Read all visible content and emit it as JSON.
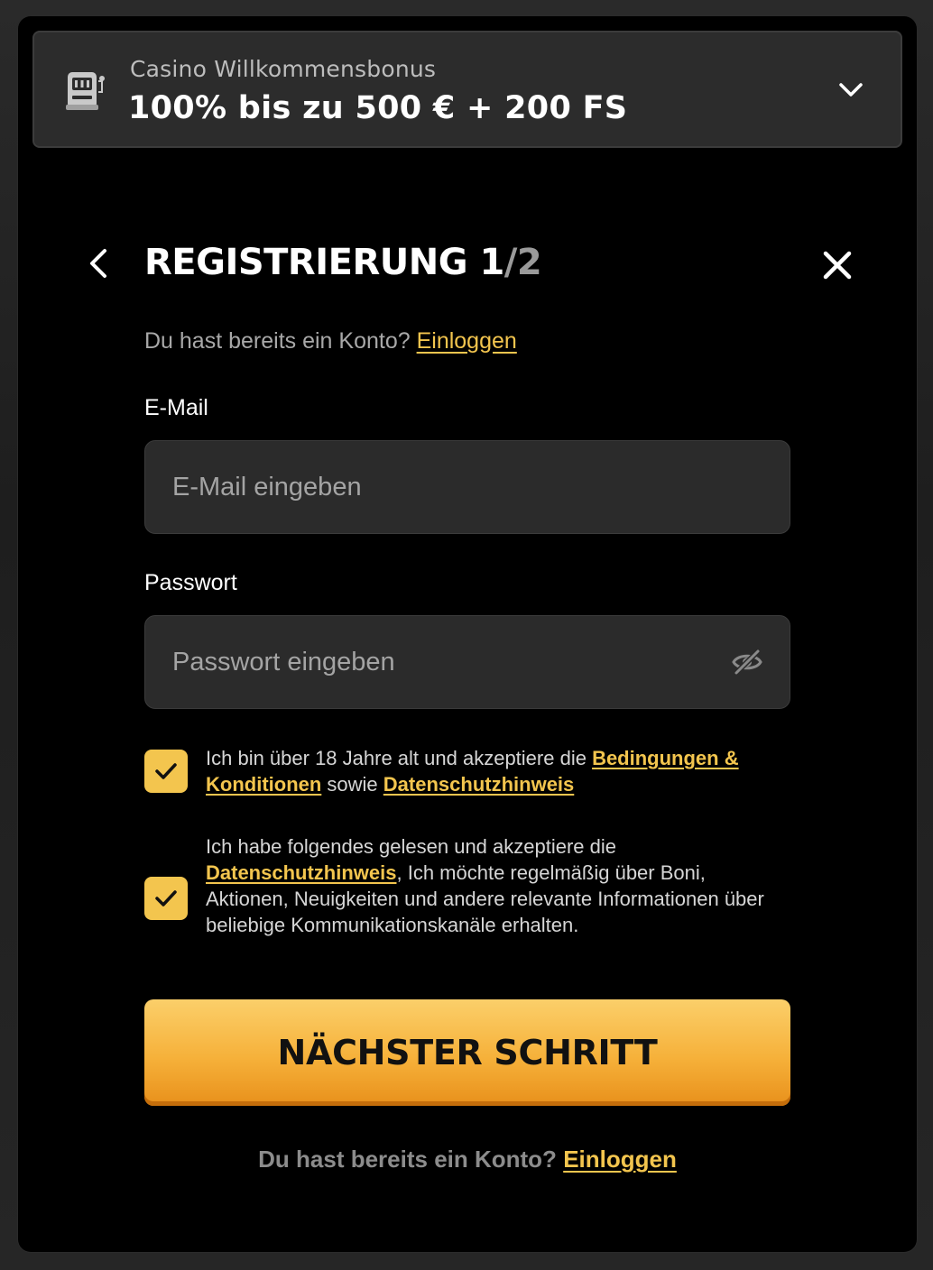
{
  "bonus": {
    "caption": "Casino Willkommensbonus",
    "amount": "100% bis zu 500 € + 200 FS",
    "icon": "slot-machine-icon"
  },
  "registration": {
    "title": "REGISTRIERUNG 1",
    "step_total": "/2"
  },
  "login_prompt": {
    "text": "Du hast bereits ein Konto?",
    "link": "Einloggen"
  },
  "email": {
    "label": "E-Mail",
    "placeholder": "E-Mail eingeben",
    "value": ""
  },
  "password": {
    "label": "Passwort",
    "placeholder": "Passwort eingeben",
    "value": ""
  },
  "consent_terms": {
    "checked": true,
    "text_before": "Ich bin über 18 Jahre alt und akzeptiere die ",
    "link_terms": "Bedingungen & Konditionen",
    "text_mid": " sowie ",
    "link_privacy": "Datenschutzhinweis"
  },
  "consent_marketing": {
    "checked": true,
    "text_before": "Ich habe folgendes gelesen und akzeptiere die ",
    "link_privacy": "Datenschutzhinweis",
    "text_after": ", Ich möchte regelmäßig über Boni, Aktionen, Neuigkeiten und andere relevante Informationen über beliebige Kommunikationskanäle erhalten."
  },
  "next_button": {
    "label": "NÄCHSTER SCHRITT"
  },
  "bottom_login": {
    "text": "Du hast bereits ein Konto?",
    "link": "Einloggen"
  },
  "colors": {
    "accent": "#f3c54e",
    "button_top": "#fbcf6a",
    "button_bottom": "#e8901b",
    "input_bg": "#2b2b2b"
  }
}
